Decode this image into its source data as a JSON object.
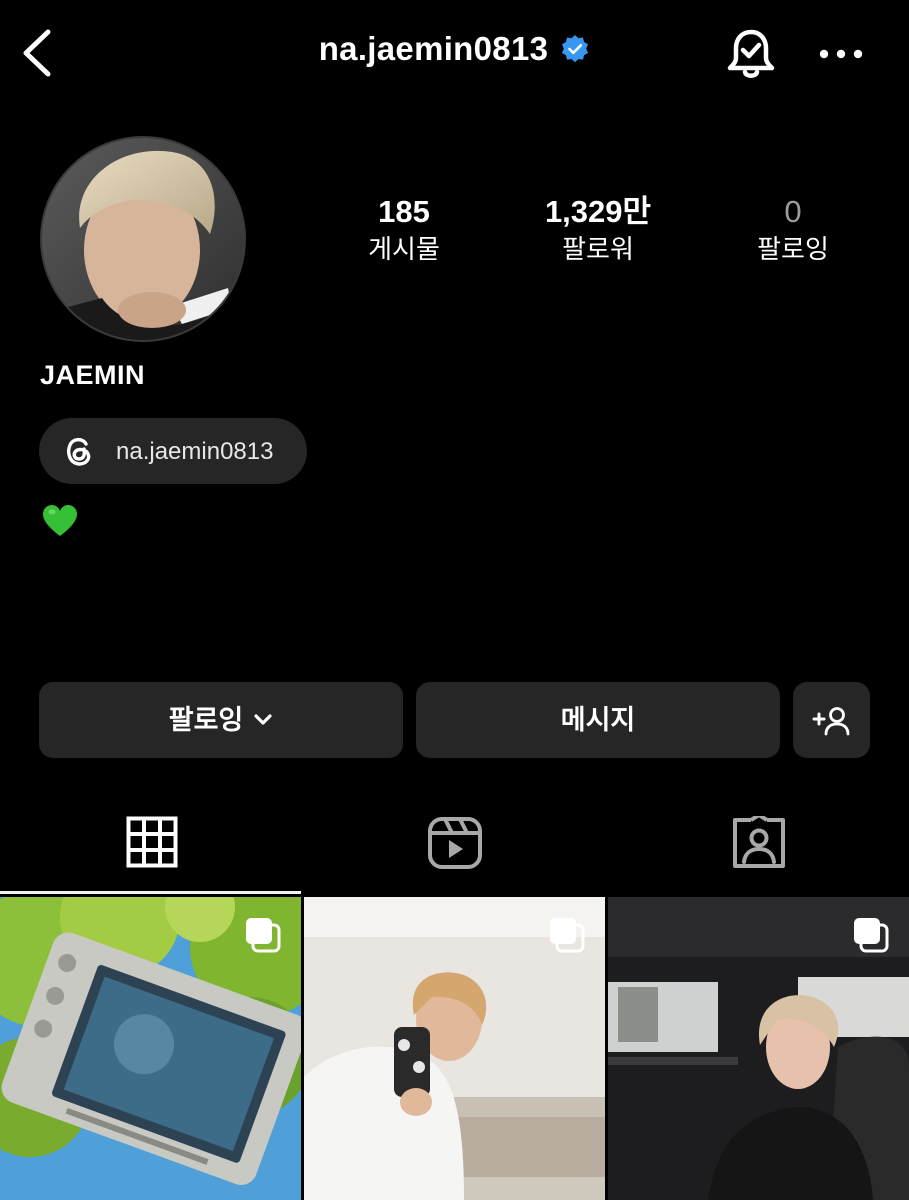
{
  "header": {
    "username": "na.jaemin0813",
    "icons": [
      "back-arrow-icon",
      "verified-badge-icon",
      "notification-bell-icon",
      "more-icon"
    ]
  },
  "profile": {
    "display_name": "JAEMIN",
    "stats": [
      {
        "value": "185",
        "label": "게시물"
      },
      {
        "value": "1,329만",
        "label": "팔로워"
      },
      {
        "value": "0",
        "label": "팔로잉"
      }
    ],
    "threads_handle": "na.jaemin0813",
    "bio_emoji": "green-heart-icon"
  },
  "actions": {
    "following_label": "팔로잉",
    "message_label": "메시지"
  },
  "tabs": [
    "grid-icon",
    "reels-icon",
    "tagged-icon"
  ],
  "colors": {
    "background": "#000000",
    "button": "#262626",
    "verified": "#3897f0",
    "heart": "#35c035"
  }
}
